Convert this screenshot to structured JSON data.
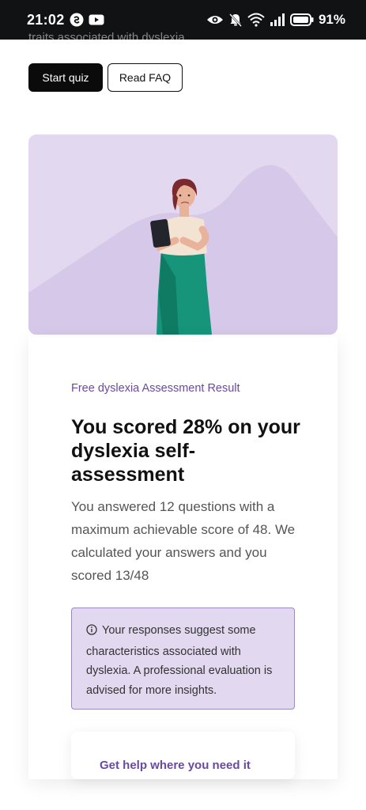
{
  "status_bar": {
    "time": "21:02",
    "battery_percent": "91%"
  },
  "top_partial_text": "traits associated with dyslexia",
  "buttons": {
    "start_quiz": "Start quiz",
    "read_faq": "Read FAQ"
  },
  "result_card": {
    "eyebrow": "Free dyslexia Assessment Result",
    "headline": "You scored 28% on your dyslexia self-assessment",
    "description": "You answered 12 questions with a maximum achievable score of 48. We calculated your answers and you scored 13/48",
    "note": "Your responses suggest some characteristics associated with dyslexia. A professional evaluation is advised for more insights."
  },
  "help_card": {
    "title": "Get help where you need it"
  },
  "colors": {
    "accent_purple": "#6a4aa0",
    "hero_bg": "#e2d8f0",
    "note_border": "#9d89bd",
    "dress_green": "#16957a"
  }
}
